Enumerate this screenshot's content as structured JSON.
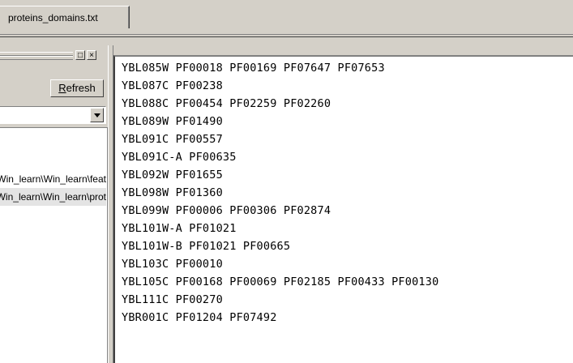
{
  "tab": {
    "label": "proteins_domains.txt"
  },
  "left_panel": {
    "window_buttons": [
      "□",
      "×"
    ],
    "refresh_label_accel": "R",
    "refresh_label_rest": "efresh",
    "combo_value": "",
    "list_items": [
      "C:\\Win_learn\\Win_learn\\feat",
      "C:\\Win_learn\\Win_learn\\prot"
    ]
  },
  "editor": {
    "lines": [
      "YBL085W PF00018 PF00169 PF07647 PF07653",
      "YBL087C PF00238",
      "YBL088C PF00454 PF02259 PF02260",
      "YBL089W PF01490",
      "YBL091C PF00557",
      "YBL091C-A PF00635",
      "YBL092W PF01655",
      "YBL098W PF01360",
      "YBL099W PF00006 PF00306 PF02874",
      "YBL101W-A PF01021",
      "YBL101W-B PF01021 PF00665",
      "YBL103C PF00010",
      "YBL105C PF00168 PF00069 PF02185 PF00433 PF00130",
      "YBL111C PF00270",
      "YBR001C PF01204 PF07492"
    ]
  }
}
